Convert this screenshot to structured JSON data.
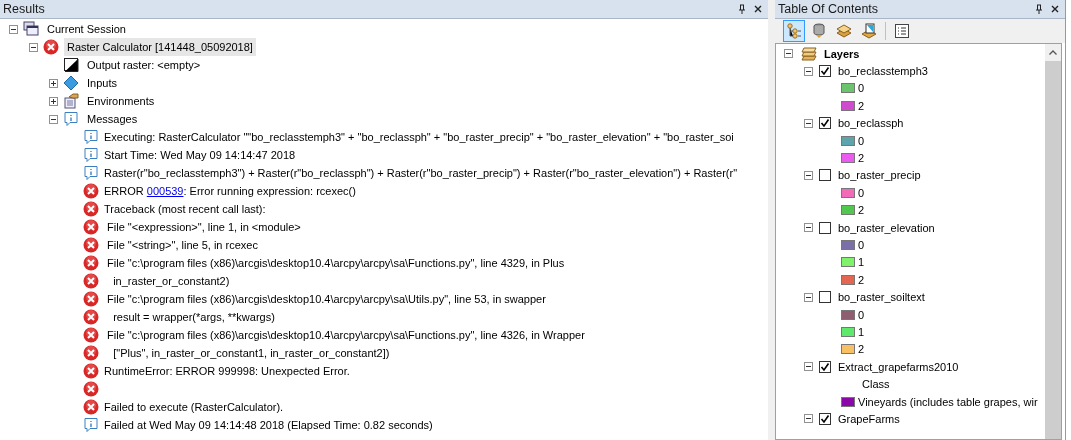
{
  "results": {
    "title": "Results",
    "tree": [
      {
        "label": "Current Session",
        "kind": "session",
        "expanded": true,
        "selected": false,
        "children": [
          {
            "label": "Raster Calculator [141448_05092018]",
            "kind": "error",
            "expanded": true,
            "selected": true,
            "children": [
              {
                "label": "Output raster: <empty>",
                "kind": "output",
                "selected": false
              },
              {
                "label": "Inputs",
                "kind": "inputs",
                "expanded": false,
                "selected": false
              },
              {
                "label": "Environments",
                "kind": "environments",
                "expanded": false,
                "selected": false
              },
              {
                "label": "Messages",
                "kind": "info",
                "expanded": true,
                "selected": false,
                "messages": [
                  {
                    "kind": "info",
                    "text": "Executing: RasterCalculator \"\"bo_reclasstemph3\" + \"bo_reclassph\" + \"bo_raster_precip\" + \"bo_raster_elevation\" + \"bo_raster_soi"
                  },
                  {
                    "kind": "info",
                    "text": "Start Time: Wed May 09 14:14:47 2018"
                  },
                  {
                    "kind": "info",
                    "text": "Raster(r\"bo_reclasstemph3\") + Raster(r\"bo_reclassph\") + Raster(r\"bo_raster_precip\") + Raster(r\"bo_raster_elevation\") + Raster(r\""
                  },
                  {
                    "kind": "error",
                    "text": "ERROR ",
                    "link": "000539",
                    "after": ": Error running expression: rcexec()"
                  },
                  {
                    "kind": "error",
                    "text": "Traceback (most recent call last):"
                  },
                  {
                    "kind": "error",
                    "text": " File \"<expression>\", line 1, in <module>"
                  },
                  {
                    "kind": "error",
                    "text": " File \"<string>\", line 5, in rcexec"
                  },
                  {
                    "kind": "error",
                    "text": " File \"c:\\program files (x86)\\arcgis\\desktop10.4\\arcpy\\arcpy\\sa\\Functions.py\", line 4329, in Plus"
                  },
                  {
                    "kind": "error",
                    "text": "   in_raster_or_constant2)"
                  },
                  {
                    "kind": "error",
                    "text": " File \"c:\\program files (x86)\\arcgis\\desktop10.4\\arcpy\\arcpy\\sa\\Utils.py\", line 53, in swapper"
                  },
                  {
                    "kind": "error",
                    "text": "   result = wrapper(*args, **kwargs)"
                  },
                  {
                    "kind": "error",
                    "text": " File \"c:\\program files (x86)\\arcgis\\desktop10.4\\arcpy\\arcpy\\sa\\Functions.py\", line 4326, in Wrapper"
                  },
                  {
                    "kind": "error",
                    "text": "   [\"Plus\", in_raster_or_constant1, in_raster_or_constant2])"
                  },
                  {
                    "kind": "error",
                    "text": "RuntimeError: ERROR 999998: Unexpected Error."
                  },
                  {
                    "kind": "error"
                  },
                  {
                    "kind": "error",
                    "text": "Failed to execute (RasterCalculator)."
                  },
                  {
                    "kind": "info",
                    "text": "Failed at Wed May 09 14:14:48 2018 (Elapsed Time: 0.82 seconds)"
                  }
                ]
              }
            ]
          }
        ]
      }
    ]
  },
  "toc": {
    "title": "Table Of Contents",
    "tools": [
      {
        "kind": "drawing-order",
        "selected": true
      },
      {
        "kind": "source",
        "selected": false
      },
      {
        "kind": "visibility",
        "selected": false
      },
      {
        "kind": "selection",
        "selected": false
      },
      {
        "kind": "options",
        "selected": false
      }
    ],
    "root": {
      "label": "Layers",
      "expanded": true,
      "layers": [
        {
          "name": "bo_reclasstemph3",
          "checked": true,
          "expanded": true,
          "legend": [
            {
              "label": "0",
              "color": "#6cc46c"
            },
            {
              "label": "2",
              "color": "#d04ccf"
            }
          ]
        },
        {
          "name": "bo_reclassph",
          "checked": true,
          "expanded": true,
          "legend": [
            {
              "label": "0",
              "color": "#5fa3ac"
            },
            {
              "label": "2",
              "color": "#ea5bef"
            }
          ]
        },
        {
          "name": "bo_raster_precip",
          "checked": false,
          "expanded": true,
          "legend": [
            {
              "label": "0",
              "color": "#f26ab8"
            },
            {
              "label": "2",
              "color": "#50c850"
            }
          ]
        },
        {
          "name": "bo_raster_elevation",
          "checked": false,
          "expanded": true,
          "legend": [
            {
              "label": "0",
              "color": "#7b6fa8"
            },
            {
              "label": "1",
              "color": "#80f26a"
            },
            {
              "label": "2",
              "color": "#e46550"
            }
          ]
        },
        {
          "name": "bo_raster_soiltext",
          "checked": false,
          "expanded": true,
          "legend": [
            {
              "label": "0",
              "color": "#8e5d70"
            },
            {
              "label": "1",
              "color": "#5ee96a"
            },
            {
              "label": "2",
              "color": "#f8c064"
            }
          ]
        },
        {
          "name": "Extract_grapefarms2010",
          "checked": true,
          "expanded": true,
          "legend": [
            {
              "kind": "heading",
              "label": "Class"
            },
            {
              "kind": "swatch",
              "label": "Vineyards (includes table grapes, wir",
              "color": "#8a08a8"
            }
          ]
        },
        {
          "name": "GrapeFarms",
          "checked": true,
          "expanded": true
        }
      ]
    }
  }
}
